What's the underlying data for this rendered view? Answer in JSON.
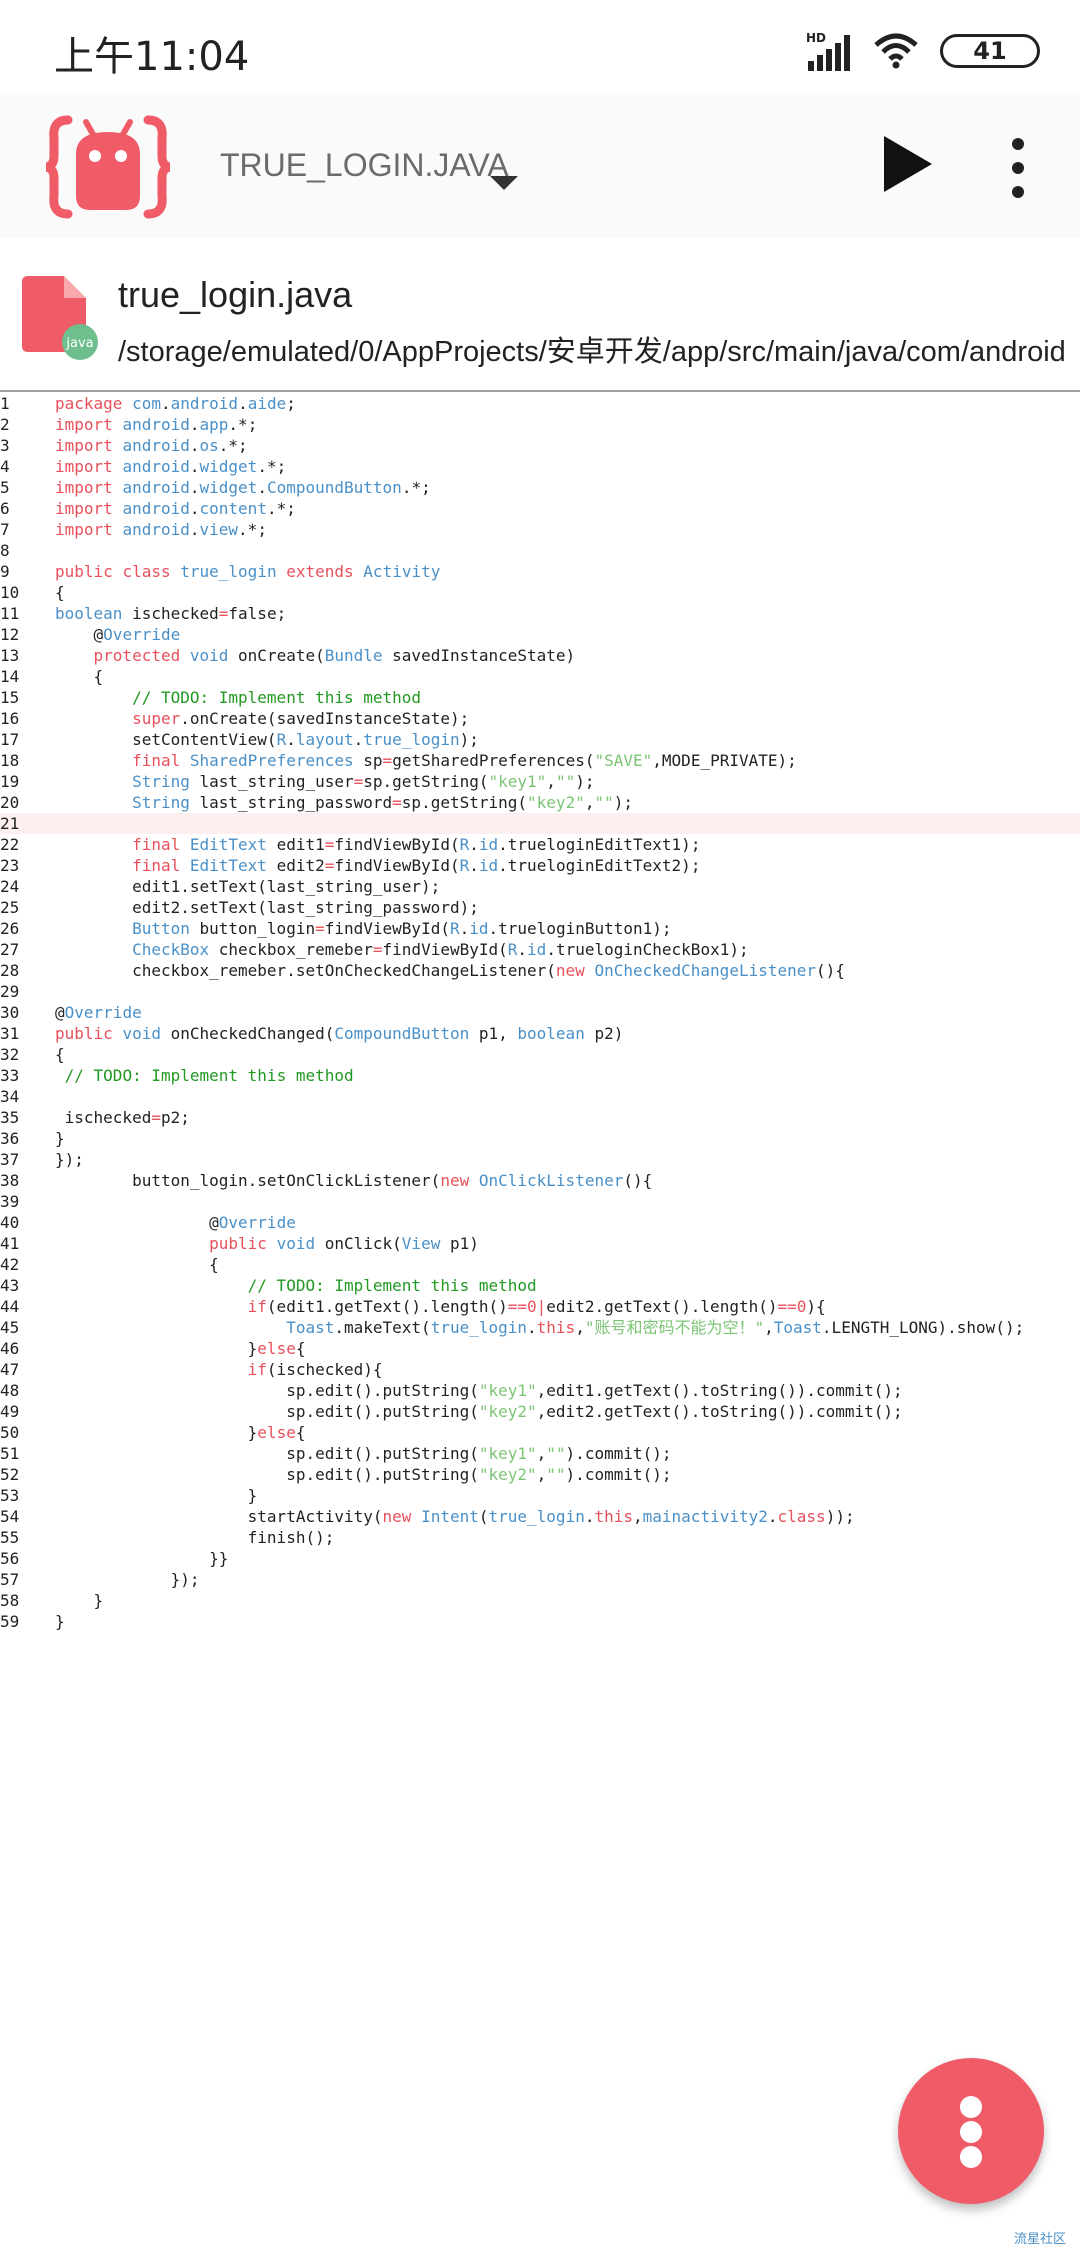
{
  "status_bar": {
    "time": "上午11:04",
    "hd_label": "HD",
    "battery": "41",
    "icons": [
      "signal-icon",
      "wifi-icon",
      "battery-icon"
    ]
  },
  "app_bar": {
    "title": "TRUE_LOGIN.JAVA",
    "icons": [
      "android-logo-icon",
      "chevron-down-icon",
      "play-icon",
      "more-vert-icon"
    ]
  },
  "file": {
    "name": "true_login.java",
    "path": "/storage/emulated/0/AppProjects/安卓开发/app/src/main/java/com/android",
    "icon_label": "java"
  },
  "colors": {
    "accent": "#ef5b66",
    "keyword": "#e8505b",
    "type": "#4a90c8",
    "string": "#7cc475",
    "comment": "#229922"
  },
  "code_lines": [
    {
      "n": "1",
      "t": "package com.android.aide;"
    },
    {
      "n": "2",
      "t": "import android.app.*;"
    },
    {
      "n": "3",
      "t": "import android.os.*;"
    },
    {
      "n": "4",
      "t": "import android.widget.*;"
    },
    {
      "n": "5",
      "t": "import android.widget.CompoundButton.*;"
    },
    {
      "n": "6",
      "t": "import android.content.*;"
    },
    {
      "n": "7",
      "t": "import android.view.*;"
    },
    {
      "n": "8",
      "t": ""
    },
    {
      "n": "9",
      "t": "public class true_login extends Activity"
    },
    {
      "n": "10",
      "t": "{"
    },
    {
      "n": "11",
      "t": "boolean ischecked=false;"
    },
    {
      "n": "12",
      "t": "    @Override"
    },
    {
      "n": "13",
      "t": "    protected void onCreate(Bundle savedInstanceState)"
    },
    {
      "n": "14",
      "t": "    {"
    },
    {
      "n": "15",
      "t": "        // TODO: Implement this method"
    },
    {
      "n": "16",
      "t": "        super.onCreate(savedInstanceState);"
    },
    {
      "n": "17",
      "t": "        setContentView(R.layout.true_login);"
    },
    {
      "n": "18",
      "t": "        final SharedPreferences sp=getSharedPreferences(\"SAVE\",MODE_PRIVATE);"
    },
    {
      "n": "19",
      "t": "        String last_string_user=sp.getString(\"key1\",\"\");"
    },
    {
      "n": "20",
      "t": "        String last_string_password=sp.getString(\"key2\",\"\");"
    },
    {
      "n": "21",
      "t": ""
    },
    {
      "n": "22",
      "t": "        final EditText edit1=findViewById(R.id.trueloginEditText1);"
    },
    {
      "n": "23",
      "t": "        final EditText edit2=findViewById(R.id.trueloginEditText2);"
    },
    {
      "n": "24",
      "t": "        edit1.setText(last_string_user);"
    },
    {
      "n": "25",
      "t": "        edit2.setText(last_string_password);"
    },
    {
      "n": "26",
      "t": "        Button button_login=findViewById(R.id.trueloginButton1);"
    },
    {
      "n": "27",
      "t": "        CheckBox checkbox_remeber=findViewById(R.id.trueloginCheckBox1);"
    },
    {
      "n": "28",
      "t": "        checkbox_remeber.setOnCheckedChangeListener(new OnCheckedChangeListener(){"
    },
    {
      "n": "29",
      "t": ""
    },
    {
      "n": "30",
      "t": "@Override"
    },
    {
      "n": "31",
      "t": "public void onCheckedChanged(CompoundButton p1, boolean p2)"
    },
    {
      "n": "32",
      "t": "{"
    },
    {
      "n": "33",
      "t": " // TODO: Implement this method"
    },
    {
      "n": "34",
      "t": ""
    },
    {
      "n": "35",
      "t": " ischecked=p2;"
    },
    {
      "n": "36",
      "t": "}"
    },
    {
      "n": "37",
      "t": "});"
    },
    {
      "n": "38",
      "t": "        button_login.setOnClickListener(new OnClickListener(){"
    },
    {
      "n": "39",
      "t": ""
    },
    {
      "n": "40",
      "t": "                @Override"
    },
    {
      "n": "41",
      "t": "                public void onClick(View p1)"
    },
    {
      "n": "42",
      "t": "                {"
    },
    {
      "n": "43",
      "t": "                    // TODO: Implement this method"
    },
    {
      "n": "44",
      "t": "                    if(edit1.getText().length()==0|edit2.getText().length()==0){"
    },
    {
      "n": "45",
      "t": "                        Toast.makeText(true_login.this,\"账号和密码不能为空！\",Toast.LENGTH_LONG).show();"
    },
    {
      "n": "46",
      "t": "                    }else{"
    },
    {
      "n": "47",
      "t": "                    if(ischecked){"
    },
    {
      "n": "48",
      "t": "                        sp.edit().putString(\"key1\",edit1.getText().toString()).commit();"
    },
    {
      "n": "49",
      "t": "                        sp.edit().putString(\"key2\",edit2.getText().toString()).commit();"
    },
    {
      "n": "50",
      "t": "                    }else{"
    },
    {
      "n": "51",
      "t": "                        sp.edit().putString(\"key1\",\"\").commit();"
    },
    {
      "n": "52",
      "t": "                        sp.edit().putString(\"key2\",\"\").commit();"
    },
    {
      "n": "53",
      "t": "                    }"
    },
    {
      "n": "54",
      "t": "                    startActivity(new Intent(true_login.this,mainactivity2.class));"
    },
    {
      "n": "55",
      "t": "                    finish();"
    },
    {
      "n": "56",
      "t": "                }}"
    },
    {
      "n": "57",
      "t": "            });"
    },
    {
      "n": "58",
      "t": "    }"
    },
    {
      "n": "59",
      "t": "}"
    }
  ],
  "highlighted_line": "21",
  "fab": {
    "icon": "more-vert-icon"
  },
  "watermark": "流星社区"
}
